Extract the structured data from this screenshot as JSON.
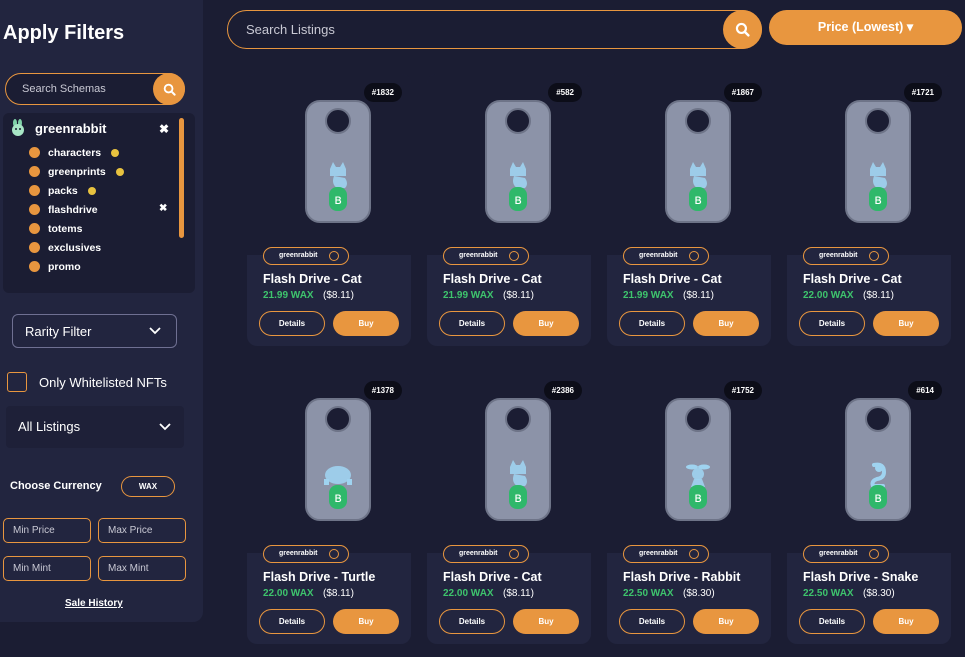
{
  "sidebar": {
    "title": "Apply Filters",
    "schema_search_placeholder": "Search Schemas",
    "collection": {
      "name": "greenrabbit",
      "schemas": [
        {
          "label": "characters",
          "coin": true,
          "x": false
        },
        {
          "label": "greenprints",
          "coin": true,
          "x": false
        },
        {
          "label": "packs",
          "coin": true,
          "x": false
        },
        {
          "label": "flashdrive",
          "coin": false,
          "x": true
        },
        {
          "label": "totems",
          "coin": false,
          "x": false
        },
        {
          "label": "exclusives",
          "coin": false,
          "x": false
        },
        {
          "label": "promo",
          "coin": false,
          "x": false
        }
      ]
    },
    "rarity_label": "Rarity Filter",
    "whitelist_label": "Only Whitelisted NFTs",
    "listings_label": "All Listings",
    "currency_label": "Choose Currency",
    "currency_value": "WAX",
    "min_price": "Min Price",
    "max_price": "Max Price",
    "min_mint": "Min Mint",
    "max_mint": "Max Mint",
    "sale_history": "Sale History"
  },
  "topbar": {
    "search_placeholder": "Search Listings",
    "sort_label": "Price (Lowest)"
  },
  "colors": {
    "accent": "#e8963f",
    "price_green": "#3ec46d",
    "background": "#1b1d33",
    "panel": "#22253f"
  },
  "cards": [
    {
      "badge": "#1832",
      "collection": "greenrabbit",
      "title": "Flash Drive - Cat",
      "price": "21.99 WAX",
      "usd": "($8.11)",
      "details": "Details",
      "buy": "Buy",
      "figure": "cat"
    },
    {
      "badge": "#582",
      "collection": "greenrabbit",
      "title": "Flash Drive - Cat",
      "price": "21.99 WAX",
      "usd": "($8.11)",
      "details": "Details",
      "buy": "Buy",
      "figure": "cat"
    },
    {
      "badge": "#1867",
      "collection": "greenrabbit",
      "title": "Flash Drive - Cat",
      "price": "21.99 WAX",
      "usd": "($8.11)",
      "details": "Details",
      "buy": "Buy",
      "figure": "cat"
    },
    {
      "badge": "#1721",
      "collection": "greenrabbit",
      "title": "Flash Drive - Cat",
      "price": "22.00 WAX",
      "usd": "($8.11)",
      "details": "Details",
      "buy": "Buy",
      "figure": "cat"
    },
    {
      "badge": "#1378",
      "collection": "greenrabbit",
      "title": "Flash Drive - Turtle",
      "price": "22.00 WAX",
      "usd": "($8.11)",
      "details": "Details",
      "buy": "Buy",
      "figure": "turtle"
    },
    {
      "badge": "#2386",
      "collection": "greenrabbit",
      "title": "Flash Drive - Cat",
      "price": "22.00 WAX",
      "usd": "($8.11)",
      "details": "Details",
      "buy": "Buy",
      "figure": "cat"
    },
    {
      "badge": "#1752",
      "collection": "greenrabbit",
      "title": "Flash Drive - Rabbit",
      "price": "22.50 WAX",
      "usd": "($8.30)",
      "details": "Details",
      "buy": "Buy",
      "figure": "rabbit"
    },
    {
      "badge": "#614",
      "collection": "greenrabbit",
      "title": "Flash Drive - Snake",
      "price": "22.50 WAX",
      "usd": "($8.30)",
      "details": "Details",
      "buy": "Buy",
      "figure": "snake"
    }
  ]
}
